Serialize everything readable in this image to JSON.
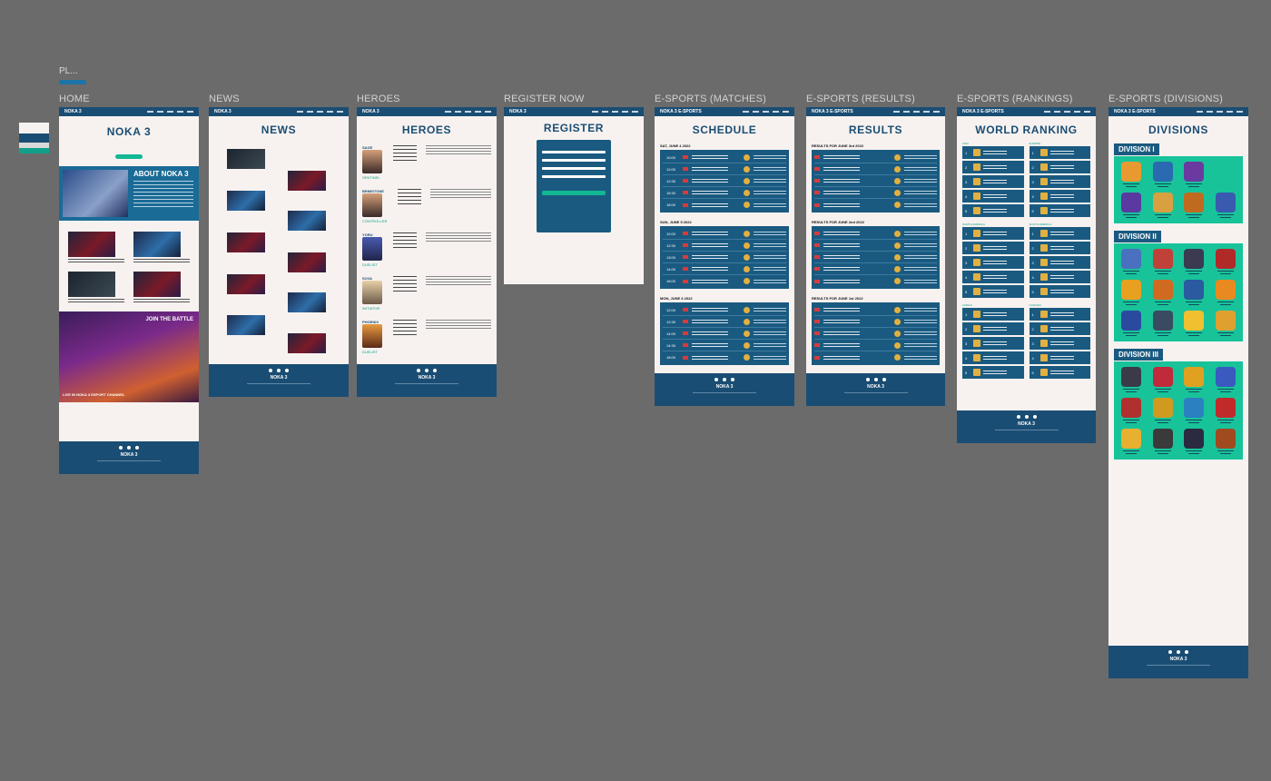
{
  "page": {
    "label": "PL..."
  },
  "frames": {
    "home": {
      "title": "HOME",
      "nav_logo": "NOKA 3",
      "heading": "NOKA 3",
      "about_heading": "ABOUT NOKA 3",
      "live_title": "JOIN THE BATTLE",
      "live_cta": "LIVE IN NOKA 3 ESPORT CHANNEL",
      "footer_logo": "NOKA 3"
    },
    "news": {
      "title": "NEWS",
      "nav_logo": "NOKA 3",
      "heading": "NEWS",
      "footer_logo": "NOKA 3"
    },
    "heroes": {
      "title": "HEROES",
      "nav_logo": "NOKA 3",
      "heading": "HEROES",
      "footer_logo": "NOKA 3",
      "heroes": [
        {
          "name": "SAGE",
          "role": "SENTINEL"
        },
        {
          "name": "BRIMSTONE",
          "role": "CONTROLLER"
        },
        {
          "name": "YORU",
          "role": "DUELIST"
        },
        {
          "name": "SOVA",
          "role": "INITIATOR"
        },
        {
          "name": "PHOENIX",
          "role": "DUELIST"
        }
      ]
    },
    "register": {
      "title": "REGISTER NOW",
      "nav_logo": "NOKA 3",
      "heading": "REGISTER",
      "button": "Register"
    },
    "matches": {
      "title": "E-SPORTS (MATCHES)",
      "nav_logo": "NOKA 3 E-SPORTS",
      "heading": "SCHEDULE",
      "footer_logo": "NOKA 3",
      "days": [
        {
          "label": "SAT, JUNE 4 2022",
          "times": [
            "10:00",
            "12:00",
            "12:30",
            "15:30",
            "18:00"
          ]
        },
        {
          "label": "SUN, JUNE 5 2022",
          "times": [
            "12:00",
            "12:30",
            "13:00",
            "14:00",
            "18:00"
          ]
        },
        {
          "label": "MON, JUNE 6 2022",
          "times": [
            "12:00",
            "12:30",
            "14:00",
            "14:30",
            "18:00"
          ]
        }
      ]
    },
    "results": {
      "title": "E-SPORTS (RESULTS)",
      "nav_logo": "NOKA 3 E-SPORTS",
      "heading": "RESULTS",
      "footer_logo": "NOKA 3",
      "days": [
        {
          "label": "RESULTS FOR JUNE 3rd 2022",
          "rows": 5
        },
        {
          "label": "RESULTS FOR JUNE 2nd 2022",
          "rows": 5
        },
        {
          "label": "RESULTS FOR JUNE 1st 2022",
          "rows": 5
        }
      ]
    },
    "rankings": {
      "title": "E-SPORTS (RANKINGS)",
      "nav_logo": "NOKA 3 E-SPORTS",
      "heading": "WORLD RANKING",
      "footer_logo": "NOKA 3",
      "regions": [
        "ASIA",
        "EUROPE",
        "NORTH AMERICA",
        "SOUTH AMERICA",
        "AFRICA",
        "OCEANIA"
      ]
    },
    "divisions": {
      "title": "E-SPORTS (DIVISIONS)",
      "nav_logo": "NOKA 3 E-SPORTS",
      "heading": "DIVISIONS",
      "footer_logo": "NOKA 3",
      "division_1": "DIVISION I",
      "division_2": "DIVISION II",
      "division_3": "DIVISION III"
    }
  },
  "colors": {
    "canvas": "#6b6b6b",
    "navy": "#1a4d73",
    "teal": "#18c39a",
    "cream": "#f7f2f0",
    "panel": "#1a5a80"
  }
}
